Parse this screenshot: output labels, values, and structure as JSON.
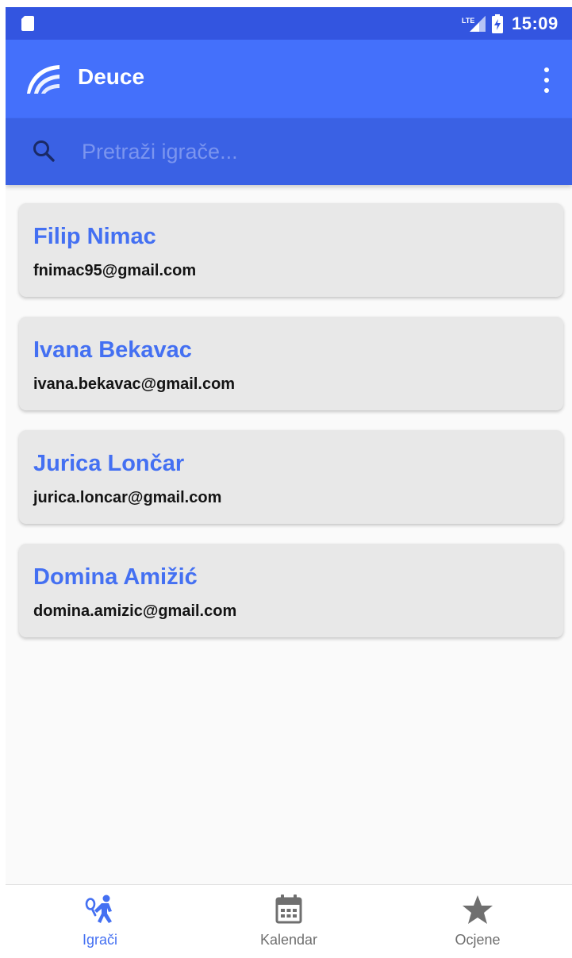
{
  "status_bar": {
    "network_label": "LTE",
    "time": "15:09"
  },
  "app_bar": {
    "title": "Deuce",
    "logo_icon": "wave-logo-icon",
    "menu_icon": "more-vert-icon"
  },
  "search": {
    "placeholder": "Pretraži igrače...",
    "value": "",
    "icon": "search-icon"
  },
  "players": [
    {
      "name": "Filip Nimac",
      "email": "fnimac95@gmail.com"
    },
    {
      "name": "Ivana Bekavac",
      "email": "ivana.bekavac@gmail.com"
    },
    {
      "name": "Jurica Lončar",
      "email": "jurica.loncar@gmail.com"
    },
    {
      "name": "Domina Amižić",
      "email": "domina.amizic@gmail.com"
    }
  ],
  "bottom_nav": {
    "items": [
      {
        "label": "Igrači",
        "icon": "tennis-player-icon",
        "active": true
      },
      {
        "label": "Kalendar",
        "icon": "calendar-icon",
        "active": false
      },
      {
        "label": "Ocjene",
        "icon": "star-icon",
        "active": false
      }
    ]
  },
  "colors": {
    "status_bar": "#3355e0",
    "app_bar": "#4470fb",
    "search_bar": "#3a61e4",
    "accent": "#4470f2",
    "card_background": "#e8e8e8",
    "inactive_icon": "#6f6f6f"
  }
}
